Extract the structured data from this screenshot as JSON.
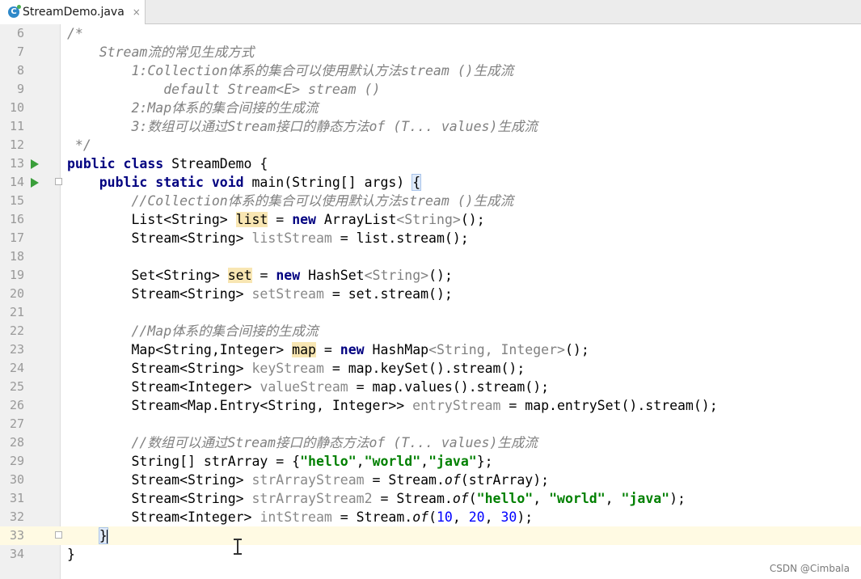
{
  "tab": {
    "filename": "StreamDemo.java",
    "close": "×"
  },
  "watermark": "CSDN @Cimbala",
  "gutter": {
    "line_numbers": [
      "6",
      "7",
      "8",
      "9",
      "10",
      "11",
      "12",
      "13",
      "14",
      "15",
      "16",
      "17",
      "18",
      "19",
      "20",
      "21",
      "22",
      "23",
      "24",
      "25",
      "26",
      "27",
      "28",
      "29",
      "30",
      "31",
      "32",
      "33",
      "34"
    ]
  },
  "code": {
    "l6": "/*",
    "l7": "    Stream流的常见生成方式",
    "l8": "        1:Collection体系的集合可以使用默认方法stream ()生成流",
    "l9": "            default Stream<E> stream ()",
    "l10": "        2:Map体系的集合间接的生成流",
    "l11": "        3:数组可以通过Stream接口的静态方法of (T... values)生成流",
    "l12": " */",
    "l13_kw": "public class",
    "l13_name": " StreamDemo {",
    "l14_kw": "public static void",
    "l14_sig": " main(String[] args) ",
    "l14_brace": "{",
    "l15": "//Collection体系的集合可以使用默认方法stream ()生成流",
    "l16_a": "List<String> ",
    "l16_var": "list",
    "l16_b": " = ",
    "l16_new": "new",
    "l16_c": " ArrayList",
    "l16_gen": "<String>",
    "l16_d": "();",
    "l17_a": "Stream<String> ",
    "l17_var": "listStream",
    "l17_b": " = list.stream();",
    "l19_a": "Set<String> ",
    "l19_var": "set",
    "l19_b": " = ",
    "l19_new": "new",
    "l19_c": " HashSet",
    "l19_gen": "<String>",
    "l19_d": "();",
    "l20_a": "Stream<String> ",
    "l20_var": "setStream",
    "l20_b": " = set.stream();",
    "l22": "//Map体系的集合间接的生成流",
    "l23_a": "Map<String,Integer> ",
    "l23_var": "map",
    "l23_b": " = ",
    "l23_new": "new",
    "l23_c": " HashMap",
    "l23_gen": "<String, Integer>",
    "l23_d": "();",
    "l24_a": "Stream<String> ",
    "l24_var": "keyStream",
    "l24_b": " = map.keySet().stream();",
    "l25_a": "Stream<Integer> ",
    "l25_var": "valueStream",
    "l25_b": " = map.values().stream();",
    "l26_a": "Stream<Map.Entry<String, Integer>> ",
    "l26_var": "entryStream",
    "l26_b": " = map.entrySet().stream();",
    "l28": "//数组可以通过Stream接口的静态方法of (T... values)生成流",
    "l29_a": "String[] strArray = {",
    "l29_s1": "\"hello\"",
    "l29_c1": ",",
    "l29_s2": "\"world\"",
    "l29_c2": ",",
    "l29_s3": "\"java\"",
    "l29_b": "};",
    "l30_a": "Stream<String> ",
    "l30_var": "strArrayStream",
    "l30_b": " = Stream.",
    "l30_of": "of",
    "l30_c": "(strArray);",
    "l31_a": "Stream<String> ",
    "l31_var": "strArrayStream2",
    "l31_b": " = Stream.",
    "l31_of": "of",
    "l31_c": "(",
    "l31_s1": "\"hello\"",
    "l31_c1": ", ",
    "l31_s2": "\"world\"",
    "l31_c2": ", ",
    "l31_s3": "\"java\"",
    "l31_d": ");",
    "l32_a": "Stream<Integer> ",
    "l32_var": "intStream",
    "l32_b": " = Stream.",
    "l32_of": "of",
    "l32_c": "(",
    "l32_n1": "10",
    "l32_c1": ", ",
    "l32_n2": "20",
    "l32_c2": ", ",
    "l32_n3": "30",
    "l32_d": ");",
    "l33": "}",
    "l34": "}"
  }
}
